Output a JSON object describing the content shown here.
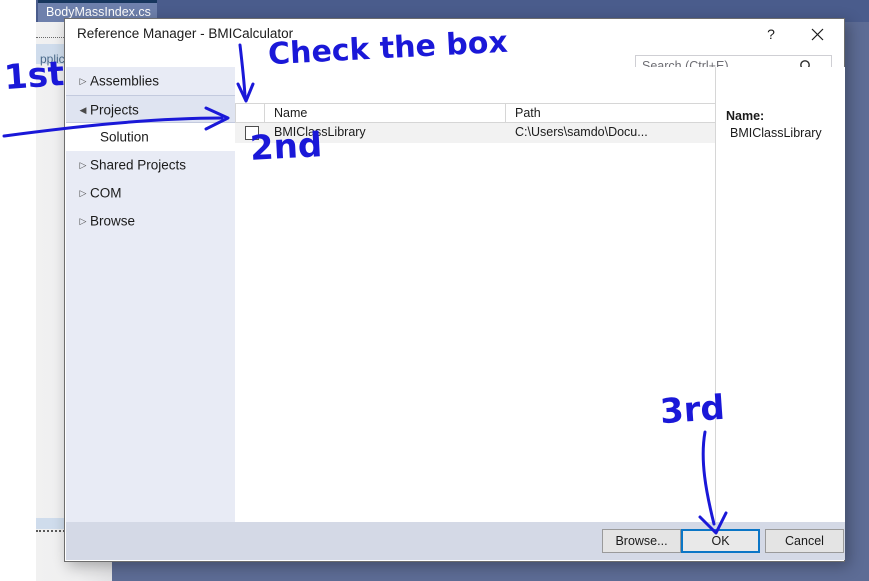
{
  "background": {
    "tab_label": "BodyMassIndex.cs",
    "side_band_label": "pplica"
  },
  "dialog": {
    "title": "Reference Manager - BMICalculator",
    "help_button": "?",
    "close_icon": "close-icon",
    "search": {
      "placeholder": "Search (Ctrl+E)",
      "value": "",
      "icon": "search-icon",
      "dropdown_icon": "chevron-down-icon"
    },
    "tree": {
      "items": [
        {
          "label": "Assemblies",
          "state": "collapsed",
          "selected": false
        },
        {
          "label": "Projects",
          "state": "expanded",
          "selected": false
        },
        {
          "label": "Solution",
          "state": "leaf",
          "selected": true
        },
        {
          "label": "Shared Projects",
          "state": "collapsed",
          "selected": false
        },
        {
          "label": "COM",
          "state": "collapsed",
          "selected": false
        },
        {
          "label": "Browse",
          "state": "collapsed",
          "selected": false
        }
      ]
    },
    "list": {
      "columns": [
        "Name",
        "Path"
      ],
      "rows": [
        {
          "checked": false,
          "name": "BMIClassLibrary",
          "path": "C:\\Users\\samdo\\Docu..."
        }
      ]
    },
    "details": {
      "name_label": "Name:",
      "name_value": "BMIClassLibrary"
    },
    "footer": {
      "browse_label": "Browse...",
      "ok_label": "OK",
      "cancel_label": "Cancel"
    }
  },
  "annotations": {
    "first": "1st",
    "check_the_box": "Check the box",
    "second": "2nd",
    "third": "3rd",
    "ink_color": "#1a18d8"
  }
}
